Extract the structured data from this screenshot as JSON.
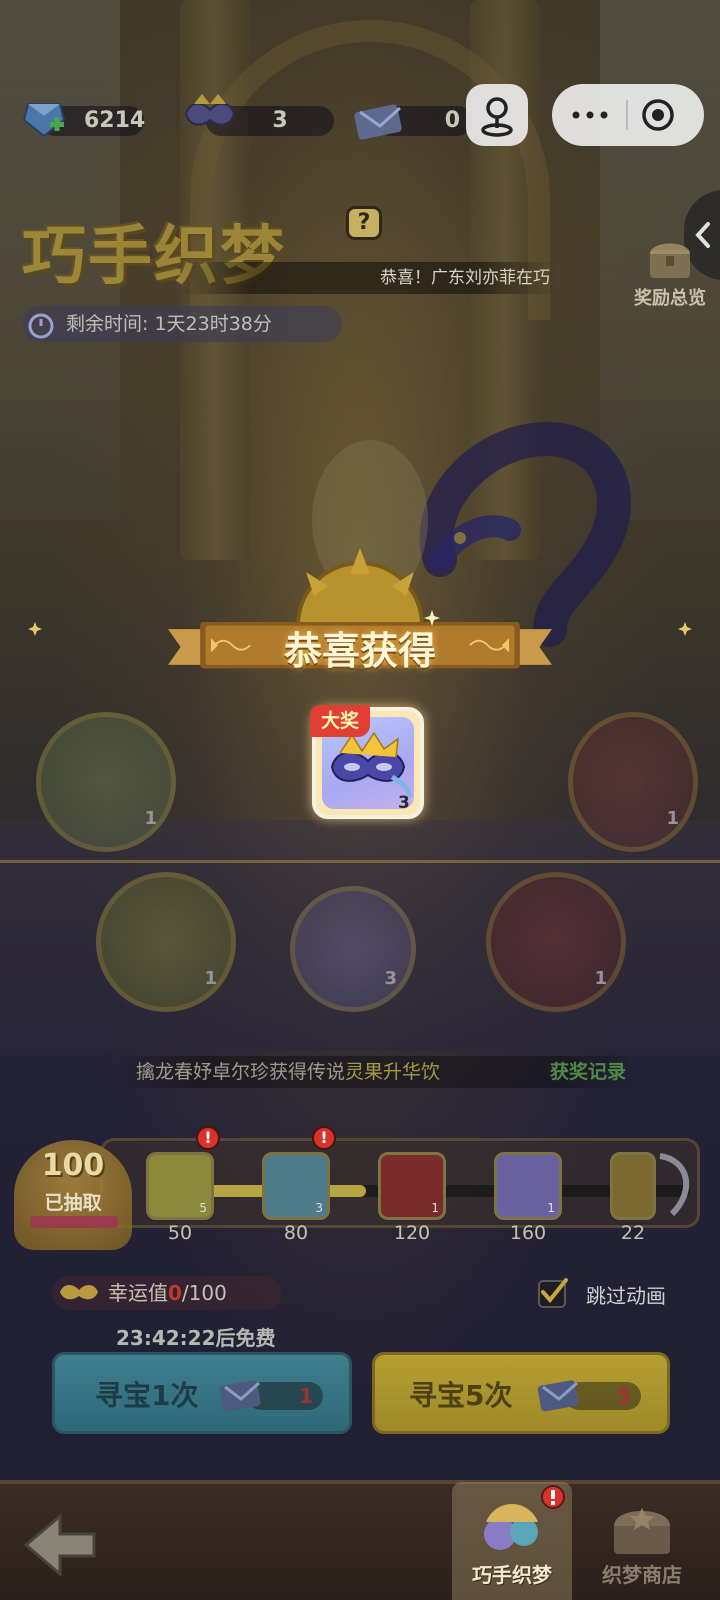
{
  "resources": {
    "gems": "6214",
    "masks": "3",
    "tickets": "0"
  },
  "header": {
    "title": "巧手织梦",
    "help": "?",
    "ticker": "恭喜！广东刘亦菲在巧",
    "timer": "剩余时间: 1天23时38分",
    "reward_overview": "奖励总览"
  },
  "reward_popup": {
    "title": "恭喜获得",
    "badge": "大奖",
    "count": "3"
  },
  "prizes": [
    {
      "icon": "potion-bottle-icon",
      "count": "1"
    },
    {
      "icon": "green-scroll-icon",
      "count": "1"
    },
    {
      "icon": "dark-stone-icon",
      "count": "1"
    },
    {
      "icon": "mask-icon",
      "count": "3"
    },
    {
      "icon": "red-potion-icon",
      "count": "1"
    }
  ],
  "announce": {
    "text": "擒龙春妤卓尔珍获得传说",
    "item": "灵果升华饮",
    "records": "获奖记录"
  },
  "progress": {
    "drawn_count": "100",
    "drawn_label": "已抽取",
    "fill_fraction": 0.4,
    "milestones": [
      {
        "value": "50",
        "count": "5",
        "alert": true
      },
      {
        "value": "80",
        "count": "3",
        "alert": true
      },
      {
        "value": "120",
        "count": "1",
        "alert": false
      },
      {
        "value": "160",
        "count": "1",
        "alert": false
      },
      {
        "value": "22",
        "count": "",
        "alert": false
      }
    ]
  },
  "luck": {
    "label": "幸运值",
    "current": "0",
    "max": "/100"
  },
  "free_timer": "23:42:22后免费",
  "skip_animation": "跳过动画",
  "buttons": {
    "draw_one": "寻宝1次",
    "draw_one_cost": "1",
    "draw_five": "寻宝5次",
    "draw_five_cost": "5"
  },
  "nav": {
    "tab_weave": "巧手织梦",
    "tab_shop": "织梦商店"
  },
  "colors": {
    "accent_gold": "#f3cf5a",
    "alert_red": "#d8332a",
    "luck_red": "#c0392b"
  }
}
